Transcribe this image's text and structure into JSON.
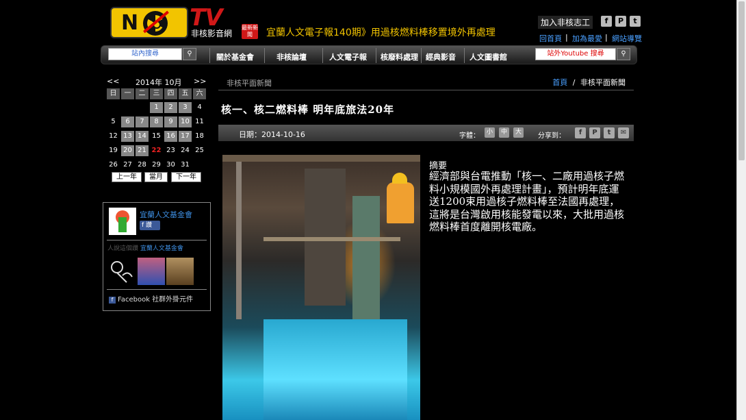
{
  "header": {
    "logo_letter": "N",
    "tv": "TV",
    "site_name": "非核影音網",
    "news_badge": "最新新聞",
    "headline": "宜蘭人文電子報140期》用過核燃料棒移置境外再處理",
    "volunteer": "加入非核志工",
    "social": [
      "f",
      "P",
      "t"
    ],
    "links": [
      "回首頁",
      "加為最愛",
      "網站導覽"
    ]
  },
  "nav": {
    "search_placeholder": "站內搜尋",
    "items": [
      "關於基金會",
      "非核論壇",
      "人文電子報",
      "核廢料處理",
      "經典影音",
      "人文圖書館"
    ],
    "youtube_search": "站外Youtube 搜尋",
    "search_icon": "search-icon"
  },
  "calendar": {
    "prev": "<<",
    "next": ">>",
    "month": "2014年 10月",
    "dow": [
      "日",
      "一",
      "二",
      "三",
      "四",
      "五",
      "六"
    ],
    "weeks": [
      [
        "",
        "",
        "",
        "1",
        "2",
        "3",
        "4"
      ],
      [
        "5",
        "6",
        "7",
        "8",
        "9",
        "10",
        "11"
      ],
      [
        "12",
        "13",
        "14",
        "15",
        "16",
        "17",
        "18"
      ],
      [
        "19",
        "20",
        "21",
        "22",
        "23",
        "24",
        "25"
      ],
      [
        "26",
        "27",
        "28",
        "29",
        "30",
        "31",
        ""
      ]
    ],
    "highlighted": [
      "1",
      "2",
      "3",
      "6",
      "7",
      "8",
      "9",
      "10",
      "13",
      "14",
      "16",
      "17",
      "20",
      "21"
    ],
    "today": "22",
    "buttons": [
      "上一年",
      "當月",
      "下一年"
    ]
  },
  "sidebar": {
    "org_name": "宜蘭人文基金會",
    "like": "讚",
    "fans_prefix": "人說這個讚",
    "fans_name": "宜蘭人文基金會",
    "plugin": "Facebook 社群外掛元件"
  },
  "main": {
    "section": "非核平面新聞",
    "breadcrumb_home": "首頁",
    "breadcrumb_sep": "/",
    "breadcrumb_current": "非核平面新聞",
    "title": "核一、核二燃料棒 明年底旅法20年",
    "date": "日期：2014-10-16",
    "fontsize_label": "字體：",
    "fontsizes": [
      "小",
      "中",
      "大"
    ],
    "share_label": "分享到：",
    "share_icons": [
      "f",
      "P",
      "t",
      "✉"
    ],
    "summary_label": "摘要",
    "summary": "經濟部與台電推動「核一、二廠用過核子燃料小規模國外再處理計畫」，預計明年底運送1200束用過核子燃料棒至法國再處理，這將是台灣啟用核能發電以來，大批用過核燃料棒首度離開核電廠。"
  }
}
